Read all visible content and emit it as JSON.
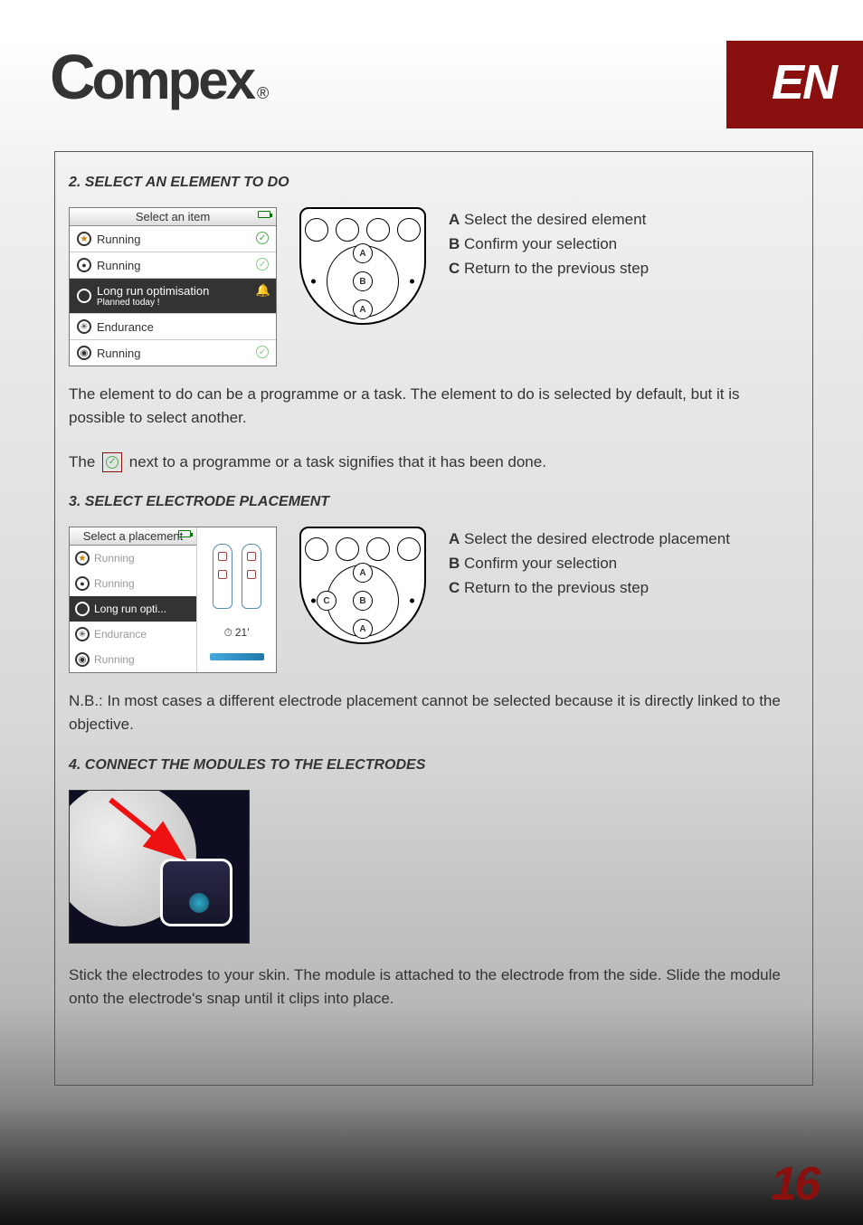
{
  "header": {
    "brand_c": "C",
    "brand_rest": "ompex",
    "reg": "®",
    "lang": "EN"
  },
  "section2": {
    "title": "2.  SELECT AN ELEMENT TO DO",
    "screen_title": "Select an item",
    "items": [
      {
        "label": "Running"
      },
      {
        "label": "Running"
      },
      {
        "label": "Long run optimisation",
        "sub": "Planned today !"
      },
      {
        "label": "Endurance"
      },
      {
        "label": "Running"
      }
    ],
    "legend": {
      "a": "Select the desired element",
      "b": "Confirm your selection",
      "c": "Return to the previous step"
    },
    "para1": "The element to do can be a programme or a task. The element to do is selected by default, but it is possible to select another.",
    "para2_a": "The",
    "para2_b": "next to a programme or a task signifies that it has been done."
  },
  "section3": {
    "title": "3.  SELECT ELECTRODE PLACEMENT",
    "screen_title": "Select a placement",
    "items": [
      {
        "label": "Running"
      },
      {
        "label": "Running"
      },
      {
        "label": "Long run opti..."
      },
      {
        "label": "Endurance"
      },
      {
        "label": "Running"
      }
    ],
    "timer": "21'",
    "legend": {
      "a": "Select the desired electrode placement",
      "b": "Confirm your selection",
      "c": "Return to the previous step"
    },
    "note": "N.B.: In most cases a different electrode placement cannot be selected because it is directly linked to the objective."
  },
  "section4": {
    "title": "4.  CONNECT THE MODULES TO THE ELECTRODES",
    "para": "Stick the electrodes to your skin. The module is attached to the electrode from the side. Slide the module onto the electrode's snap until it clips into place."
  },
  "labels": {
    "A": "A",
    "B": "B",
    "C": "C"
  },
  "page_number": "16"
}
